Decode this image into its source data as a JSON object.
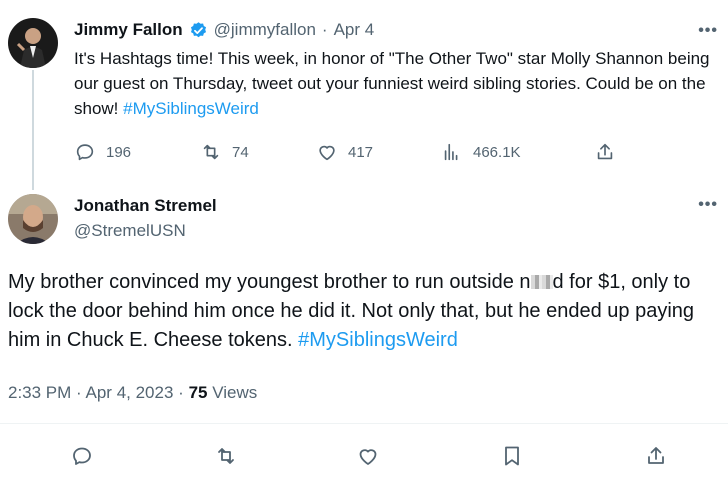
{
  "tweet1": {
    "author_name": "Jimmy Fallon",
    "handle": "@jimmyfallon",
    "separator": "·",
    "date": "Apr 4",
    "text_parts": [
      "It's Hashtags time! This week, in honor of \"The Other Two\" star Molly Shannon being our guest on Thursday, tweet out your funniest weird sibling stories. Could be on the show! "
    ],
    "hashtag": "#MySiblingsWeird",
    "replies": "196",
    "retweets": "74",
    "likes": "417",
    "views": "466.1K",
    "icons": [
      "verified-badge-icon",
      "reply-icon",
      "retweet-icon",
      "like-icon",
      "views-icon",
      "share-icon",
      "more-icon"
    ]
  },
  "tweet2": {
    "author_name": "Jonathan Stremel",
    "handle": "@StremelUSN",
    "text_before": "My brother convinced my youngest brother to run outside n",
    "text_after": "d for $1, only to lock the door behind him once he did it. Not only that, but he ended up paying him in Chuck E. Cheese tokens. ",
    "hashtag": "#MySiblingsWeird",
    "time": "2:33 PM",
    "dot": "·",
    "date": "Apr 4, 2023",
    "views_count": "75",
    "views_label": "Views",
    "icons": [
      "reply-icon",
      "retweet-icon",
      "like-icon",
      "bookmark-icon",
      "share-icon",
      "more-icon"
    ]
  },
  "colors": {
    "accent": "#1d9bf0",
    "muted": "#536471",
    "text": "#0f1419",
    "divider": "#eff3f4"
  }
}
